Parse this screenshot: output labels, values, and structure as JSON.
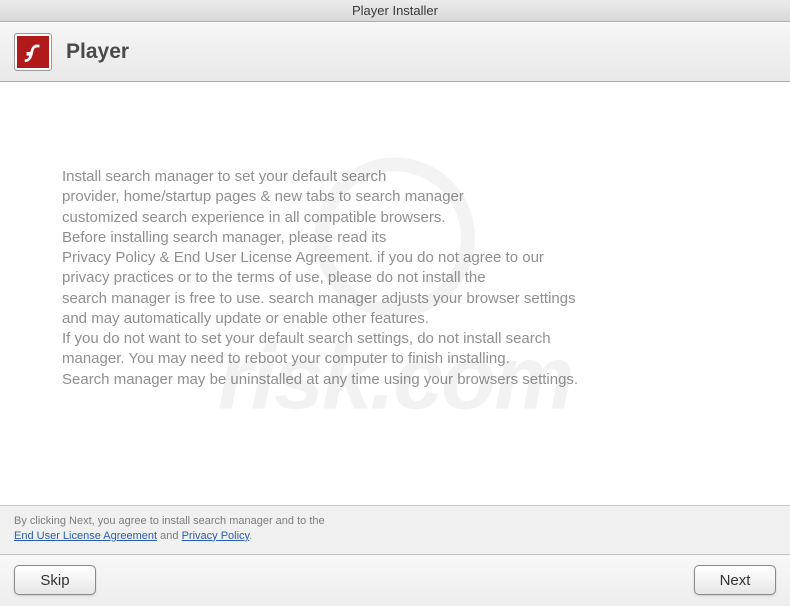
{
  "titlebar": "Player Installer",
  "header": {
    "title": "Player"
  },
  "content": {
    "body": "Install search manager to set your default search\nprovider, home/startup pages & new tabs to search manager\ncustomized search experience in all compatible browsers.\nBefore installing search manager, please read its\nPrivacy Policy & End User License Agreement. if you do not agree to our\nprivacy practices or to the terms of use, please do not install the\nsearch manager is free to use. search manager adjusts your browser settings\nand may automatically update or enable other features.\nIf you do not want to set your default search settings, do not install search\nmanager. You may need to reboot your computer to finish installing.\nSearch manager may be uninstalled at any time using your browsers settings."
  },
  "footer": {
    "agree_prefix": "By clicking Next, you agree to install search manager and to the",
    "eula_link": "End User License Agreement",
    "and_word": "and",
    "privacy_link": "Privacy Policy",
    "skip_label": "Skip",
    "next_label": "Next"
  },
  "watermark": {
    "text": "risk.com"
  }
}
